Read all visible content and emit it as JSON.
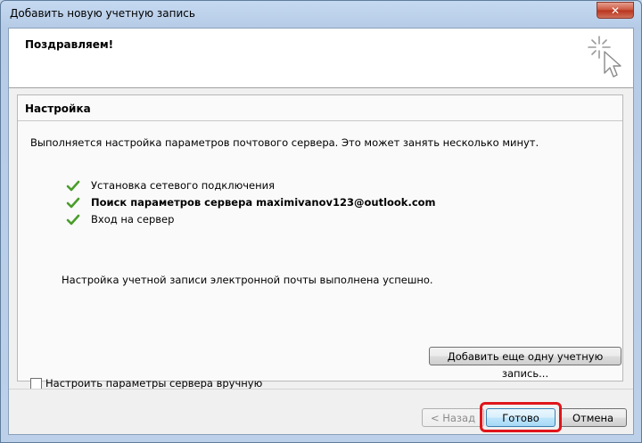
{
  "window": {
    "title": "Добавить новую учетную запись",
    "close_label": "✕"
  },
  "header": {
    "title": "Поздравляем!",
    "icon": "wizard-sparkle-icon"
  },
  "setup": {
    "section_title": "Настройка",
    "status": "Выполняется настройка параметров почтового сервера. Это может занять несколько минут.",
    "steps": [
      {
        "label": "Установка сетевого подключения",
        "done": true
      },
      {
        "label": "Поиск параметров сервера maximivanov123@outlook.com",
        "done": true
      },
      {
        "label": "Вход на сервер",
        "done": true
      }
    ],
    "success_message": "Настройка учетной записи электронной почты выполнена успешно.",
    "manual_label": "Настроить параметры сервера вручную",
    "add_another_label": "Добавить еще одну учетную запись..."
  },
  "footer": {
    "back_label": "< Назад",
    "finish_label": "Готово",
    "cancel_label": "Отмена"
  },
  "colors": {
    "check": "#4a9d2a",
    "highlight": "#e0151a"
  }
}
